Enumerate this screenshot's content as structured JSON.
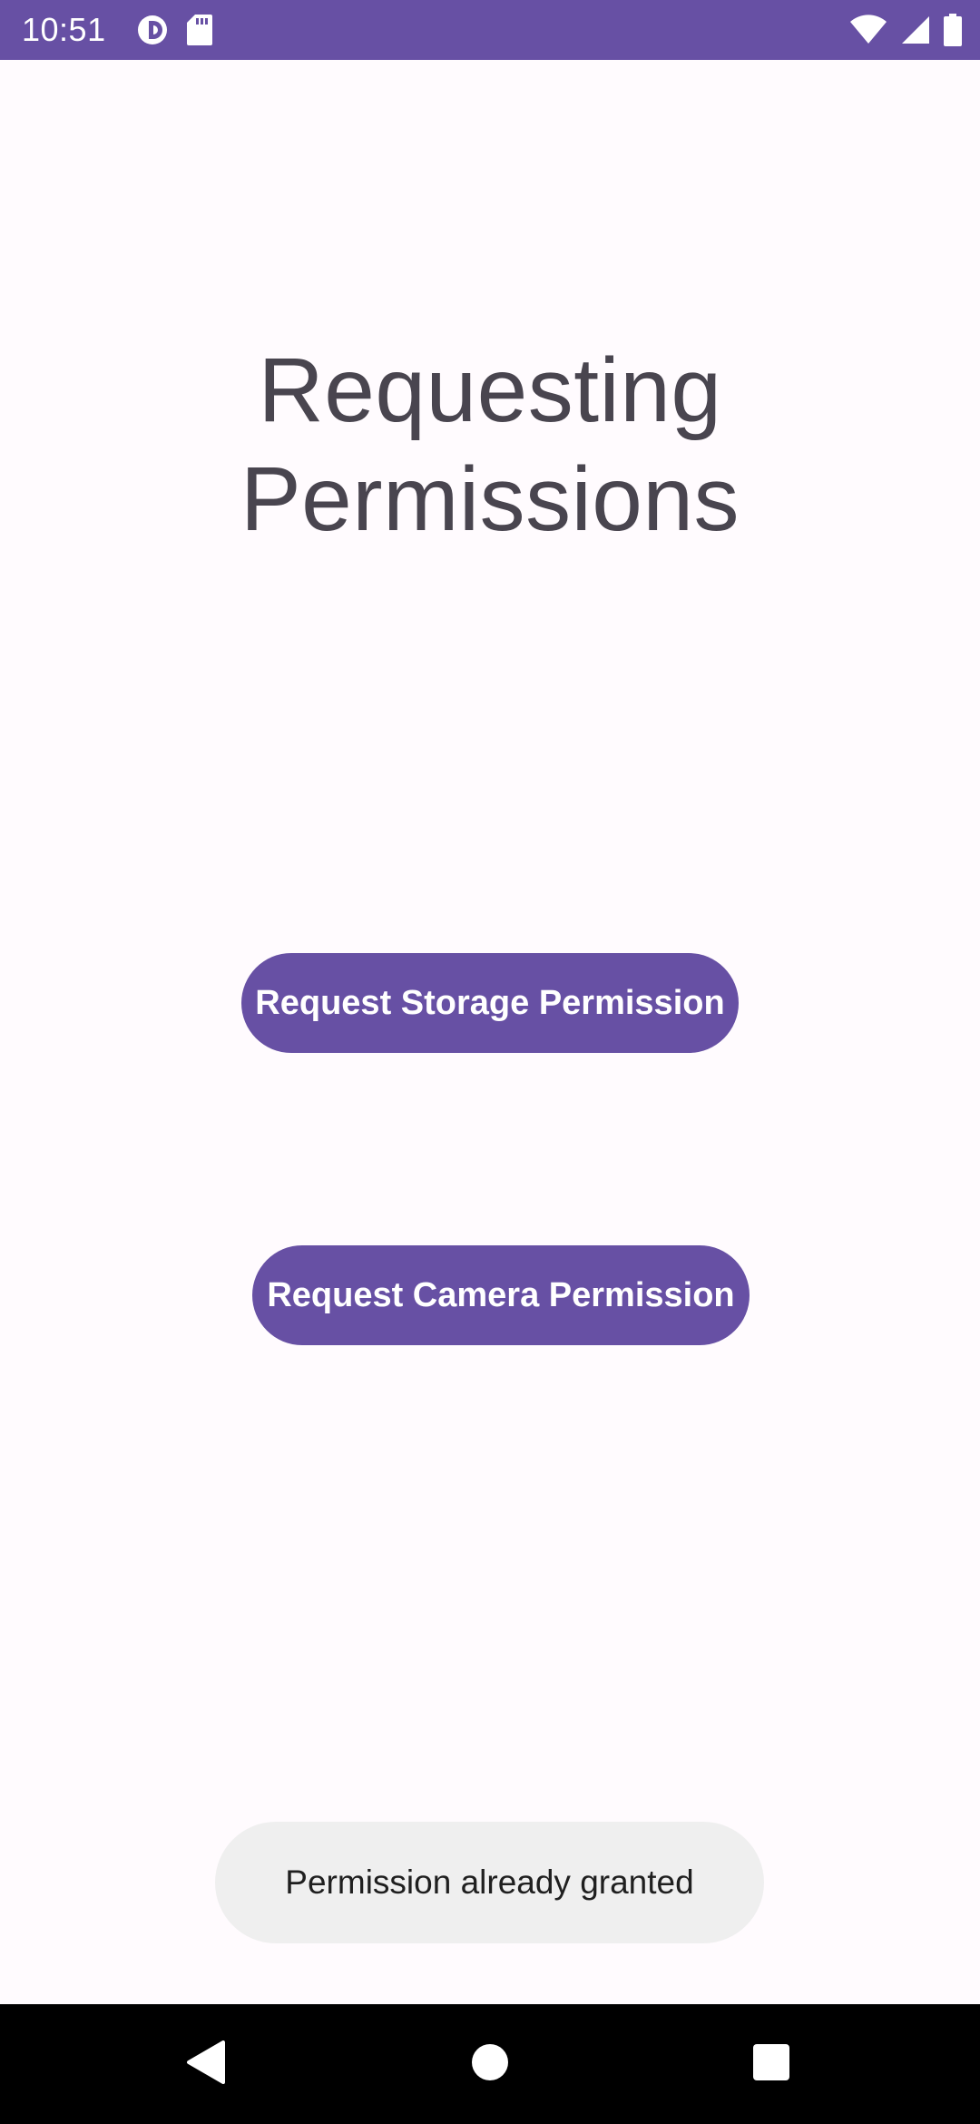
{
  "status_bar": {
    "time": "10:51",
    "left_icons": [
      "data-saver-icon",
      "sd-card-icon"
    ],
    "right_icons": [
      "wifi-icon",
      "cellular-signal-icon",
      "battery-icon"
    ],
    "background_color": "#6750a4"
  },
  "main": {
    "title": "Requesting Permissions",
    "buttons": [
      {
        "label": "Request Storage Permission"
      },
      {
        "label": "Request Camera Permission"
      }
    ],
    "accent_color": "#6750a4"
  },
  "toast": {
    "message": "Permission already granted"
  },
  "nav_bar": {
    "icons": [
      "back-icon",
      "home-icon",
      "recents-icon"
    ]
  }
}
